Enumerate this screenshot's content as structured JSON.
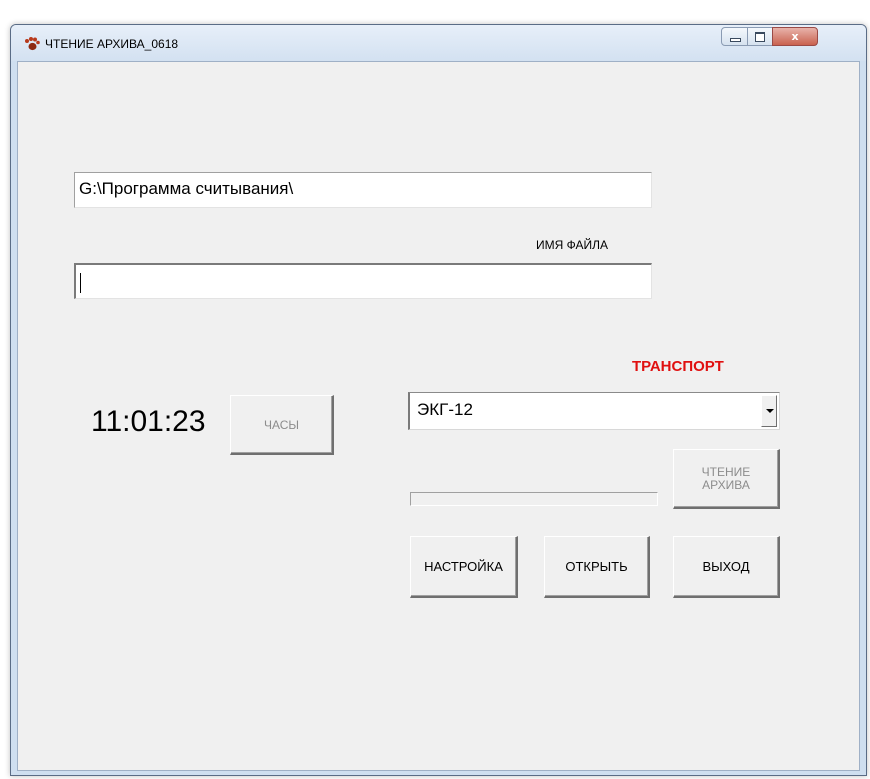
{
  "window": {
    "title": "ЧТЕНИЕ АРХИВА_0618",
    "icon": "paw-icon",
    "controls": {
      "minimize": "minimize-icon",
      "maximize": "maximize-icon",
      "close": "close-icon",
      "close_glyph": "x"
    }
  },
  "form": {
    "path_value": "G:\\Программа считывания\\",
    "filename_label": "ИМЯ ФАЙЛА",
    "filename_value": "",
    "transport_label": "ТРАНСПОРТ",
    "transport_selected": "ЭКГ-12",
    "clock_time": "11:01:23",
    "clock_button": "ЧАСЫ",
    "read_archive_button": "ЧТЕНИЕ АРХИВА",
    "progress": 0,
    "settings_button": "НАСТРОЙКА",
    "open_button": "ОТКРЫТЬ",
    "exit_button": "ВЫХОД"
  },
  "colors": {
    "transport_label": "#e01010",
    "client_bg": "#f0f0f0",
    "disabled_text": "#8c8c8c"
  }
}
